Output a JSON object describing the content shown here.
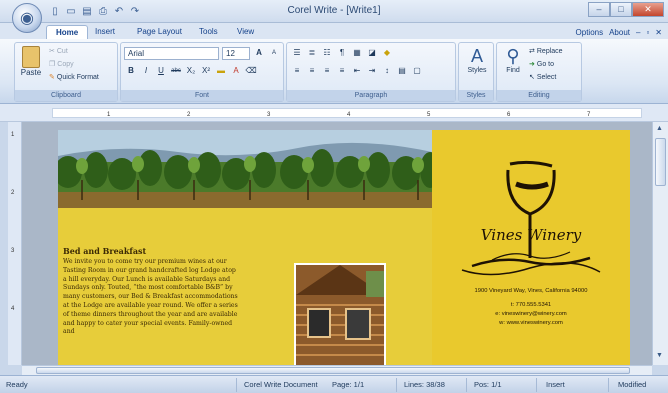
{
  "window": {
    "title": "Corel Write - [Write1]"
  },
  "quick_access": [
    {
      "icon": "new-doc-icon",
      "glyph": "▯"
    },
    {
      "icon": "open-folder-icon",
      "glyph": "▭"
    },
    {
      "icon": "save-icon",
      "glyph": "▤"
    },
    {
      "icon": "print-icon",
      "glyph": "⎙"
    },
    {
      "icon": "undo-icon",
      "glyph": "↶"
    },
    {
      "icon": "redo-icon",
      "glyph": "↷"
    }
  ],
  "tabs": [
    "Home",
    "Insert",
    "Page Layout",
    "Tools",
    "View"
  ],
  "right_nav": {
    "options": "Options",
    "about": "About"
  },
  "clipboard": {
    "paste": "Paste",
    "cut": "Cut",
    "copy": "Copy",
    "quick_format": "Quick Format",
    "label": "Clipboard"
  },
  "font": {
    "name": "Arial",
    "size": "12",
    "label": "Font",
    "bold": "B",
    "italic": "I",
    "underline": "U",
    "strike": "abc",
    "subscript": "X₂",
    "superscript": "X²",
    "grow": "A",
    "shrink": "A"
  },
  "paragraph": {
    "label": "Paragraph"
  },
  "styles": {
    "button": "Styles",
    "label": "Styles"
  },
  "editing": {
    "find": "Find",
    "replace": "Replace",
    "goto": "Go to",
    "select": "Select",
    "label": "Editing"
  },
  "ruler": {
    "ticks": [
      "1",
      "2",
      "3",
      "4",
      "5",
      "6",
      "7"
    ],
    "v_ticks": [
      "1",
      "2",
      "3",
      "4"
    ]
  },
  "document": {
    "heading": "Bed and Breakfast",
    "body": "We invite you to come try our premium wines at our Tasting Room in our grand handcrafted log Lodge atop a hill everyday. Our Lunch is available Saturdays and Sundays only. Touted, “the most comfortable B&B” by many customers, our Bed & Breakfast accommodations at the Lodge are available year round. We offer a series of theme dinners throughout the year and are available and happy to cater your special events. Family-owned and",
    "brand": "Vines Winery",
    "address": "1900 Vineyard Way, Vines, California 94000",
    "phone": "t: 770.555.5341",
    "email": "e: vineswinery@winery.com",
    "web": "w: www.vineswinery.com"
  },
  "status": {
    "left": "Ready",
    "doc_type": "Corel Write Document",
    "page": "Page: 1/1",
    "lines": "Lines: 38/38",
    "pos": "Pos: 1/1",
    "mode": "Insert",
    "modified": "Modified"
  },
  "colors": {
    "accent": "#15428b",
    "page_yellow": "#e8cf3c"
  }
}
